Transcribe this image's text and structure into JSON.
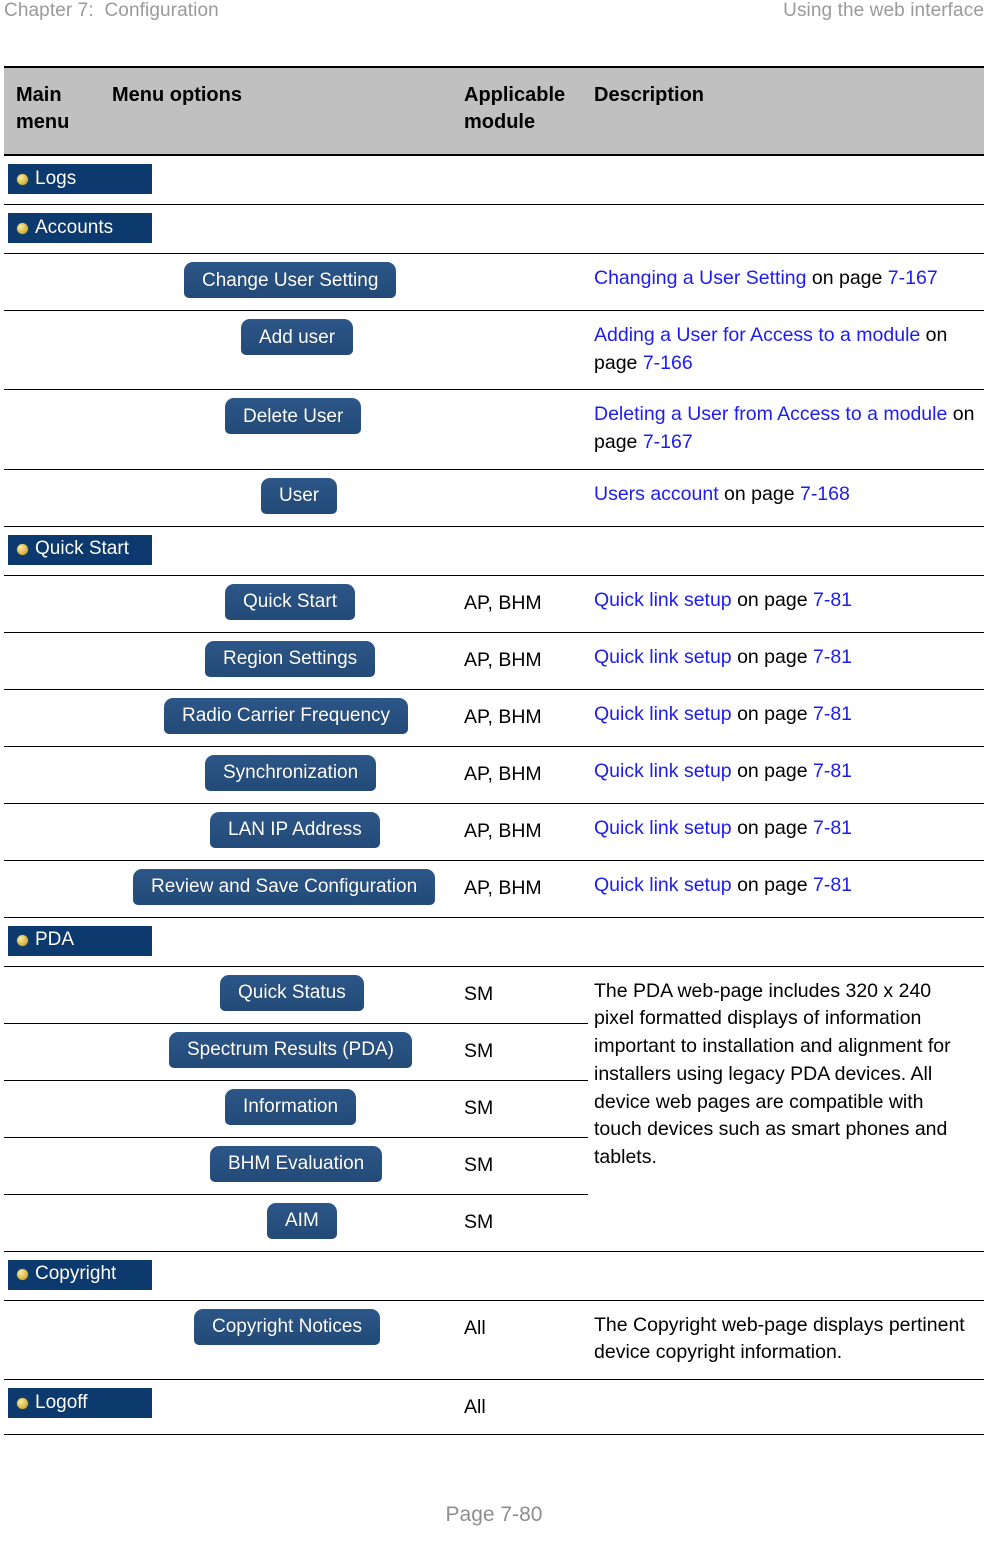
{
  "header": {
    "chapter": "Chapter 7:  Configuration",
    "section": "Using the web interface"
  },
  "footer": {
    "page_label": "Page 7-80"
  },
  "colors": {
    "menu_bar_bg": "#0c3a6e",
    "menu_button_bg": "#27507f",
    "bullet_gold": "#e3c457",
    "header_row_bg": "#c0c0c0",
    "xref_link": "#1d1df0",
    "running_head": "#9a9a9a"
  },
  "table": {
    "columns": [
      {
        "key": "main_menu",
        "label": "Main\nmenu"
      },
      {
        "key": "menu_options",
        "label": "Menu options"
      },
      {
        "key": "applicable_module",
        "label": "Applicable\nmodule"
      },
      {
        "key": "description",
        "label": "Description"
      }
    ],
    "header": {
      "main_menu": "Main menu",
      "main_menu_line1": "Main",
      "main_menu_line2": "menu",
      "menu_options": "Menu options",
      "applicable_module_line1": "Applicable",
      "applicable_module_line2": "module",
      "description": "Description"
    },
    "rows": [
      {
        "type": "main",
        "main_menu": "Logs",
        "menu_option": "",
        "applicable_module": "",
        "description_parts": []
      },
      {
        "type": "main",
        "main_menu": "Accounts",
        "menu_option": "",
        "applicable_module": "",
        "description_parts": []
      },
      {
        "type": "sub",
        "main_menu": "",
        "menu_option": "Change User Setting",
        "applicable_module": "",
        "description_parts": [
          {
            "text": "Changing a User Setting",
            "style": "xref"
          },
          {
            "text": " on page ",
            "style": "plain"
          },
          {
            "text": "7-167",
            "style": "xref"
          }
        ]
      },
      {
        "type": "sub",
        "main_menu": "",
        "menu_option": "Add user",
        "applicable_module": "",
        "description_parts": [
          {
            "text": "Adding a User for Access to a module",
            "style": "xref"
          },
          {
            "text": " on page ",
            "style": "plain"
          },
          {
            "text": "7-166",
            "style": "xref"
          }
        ]
      },
      {
        "type": "sub",
        "main_menu": "",
        "menu_option": "Delete User",
        "applicable_module": "",
        "description_parts": [
          {
            "text": "Deleting a User from Access to a module",
            "style": "xref"
          },
          {
            "text": " on page ",
            "style": "plain"
          },
          {
            "text": "7-167",
            "style": "xref"
          }
        ]
      },
      {
        "type": "sub",
        "main_menu": "",
        "menu_option": "User",
        "applicable_module": "",
        "description_parts": [
          {
            "text": "Users account",
            "style": "xref"
          },
          {
            "text": " on page ",
            "style": "plain"
          },
          {
            "text": "7-168",
            "style": "xref"
          }
        ]
      },
      {
        "type": "main",
        "main_menu": "Quick Start",
        "menu_option": "",
        "applicable_module": "",
        "description_parts": []
      },
      {
        "type": "sub",
        "main_menu": "",
        "menu_option": "Quick Start",
        "applicable_module": "AP, BHM",
        "description_parts": [
          {
            "text": "Quick link setup",
            "style": "xref"
          },
          {
            "text": " on page ",
            "style": "plain"
          },
          {
            "text": "7-81",
            "style": "xref"
          }
        ]
      },
      {
        "type": "sub",
        "main_menu": "",
        "menu_option": "Region Settings",
        "applicable_module": "AP, BHM",
        "description_parts": [
          {
            "text": "Quick link setup",
            "style": "xref"
          },
          {
            "text": " on page ",
            "style": "plain"
          },
          {
            "text": "7-81",
            "style": "xref"
          }
        ]
      },
      {
        "type": "sub",
        "main_menu": "",
        "menu_option": "Radio Carrier Frequency",
        "applicable_module": "AP, BHM",
        "description_parts": [
          {
            "text": "Quick link setup",
            "style": "xref"
          },
          {
            "text": " on page ",
            "style": "plain"
          },
          {
            "text": "7-81",
            "style": "xref"
          }
        ]
      },
      {
        "type": "sub",
        "main_menu": "",
        "menu_option": "Synchronization",
        "applicable_module": "AP, BHM",
        "description_parts": [
          {
            "text": "Quick link setup",
            "style": "xref"
          },
          {
            "text": " on page ",
            "style": "plain"
          },
          {
            "text": "7-81",
            "style": "xref"
          }
        ]
      },
      {
        "type": "sub",
        "main_menu": "",
        "menu_option": "LAN IP Address",
        "applicable_module": "AP, BHM",
        "description_parts": [
          {
            "text": "Quick link setup",
            "style": "xref"
          },
          {
            "text": " on page ",
            "style": "plain"
          },
          {
            "text": "7-81",
            "style": "xref"
          }
        ]
      },
      {
        "type": "sub",
        "main_menu": "",
        "menu_option": "Review and Save Configuration",
        "applicable_module": "AP, BHM",
        "description_parts": [
          {
            "text": "Quick link setup",
            "style": "xref"
          },
          {
            "text": " on page ",
            "style": "plain"
          },
          {
            "text": "7-81",
            "style": "xref"
          }
        ]
      },
      {
        "type": "main",
        "main_menu": "PDA",
        "menu_option": "",
        "applicable_module": "",
        "description_parts": []
      },
      {
        "type": "sub",
        "main_menu": "",
        "menu_option": "Quick Status",
        "applicable_module": "SM",
        "description_rowspan": 5,
        "description_text": "The PDA web-page includes 320 x 240 pixel formatted displays of information important to installation and alignment for installers using legacy PDA devices. All device web pages are compatible with touch devices such as smart phones and tablets."
      },
      {
        "type": "sub",
        "main_menu": "",
        "menu_option": "Spectrum Results (PDA)",
        "applicable_module": "SM"
      },
      {
        "type": "sub",
        "main_menu": "",
        "menu_option": "Information",
        "applicable_module": "SM"
      },
      {
        "type": "sub",
        "main_menu": "",
        "menu_option": "BHM Evaluation",
        "applicable_module": "SM"
      },
      {
        "type": "sub",
        "main_menu": "",
        "menu_option": "AIM",
        "applicable_module": "SM"
      },
      {
        "type": "main",
        "main_menu": "Copyright",
        "menu_option": "",
        "applicable_module": "",
        "description_parts": []
      },
      {
        "type": "sub",
        "main_menu": "",
        "menu_option": "Copyright Notices",
        "applicable_module": "All",
        "description_text": "The Copyright web-page displays pertinent device copyright information."
      },
      {
        "type": "main",
        "main_menu": "Logoff",
        "menu_option": "",
        "applicable_module": "All",
        "description_parts": []
      }
    ]
  }
}
